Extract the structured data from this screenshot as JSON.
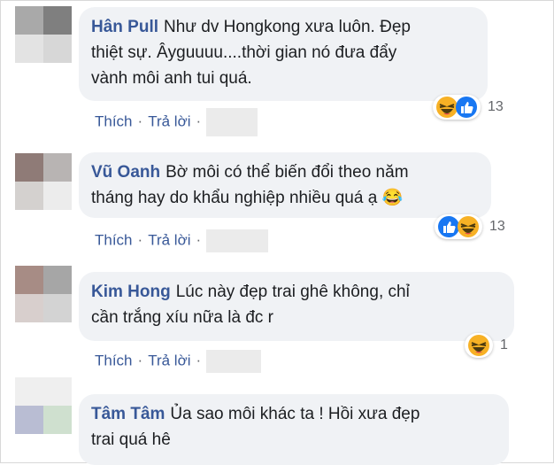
{
  "comments": [
    {
      "author": "Hân Pull",
      "text_lines": [
        "Như dv Hongkong xưa luôn. Đẹp",
        "thiệt sự. Âyguuuu....thời gian nó đưa đẩy",
        "vành môi anh tui quá."
      ],
      "actions": {
        "like": "Thích",
        "reply": "Trả lời"
      },
      "reaction_count": "13",
      "reactions": [
        "haha-icon",
        "like-icon"
      ],
      "avatar_colors": [
        "#a9a9a9",
        "#7f7f7f",
        "#e3e3e3",
        "#d7d7d7"
      ]
    },
    {
      "author": "Vũ Oanh",
      "text_lines": [
        "Bờ môi có thể biến đổi theo năm",
        "tháng hay do khẩu nghiệp nhiều quá ạ 😂"
      ],
      "actions": {
        "like": "Thích",
        "reply": "Trả lời"
      },
      "reaction_count": "13",
      "reactions": [
        "like-icon",
        "haha-icon"
      ],
      "avatar_colors": [
        "#8f7b77",
        "#b8b4b3",
        "#d4d1cf",
        "#ececec"
      ]
    },
    {
      "author": "Kim Hong",
      "text_lines": [
        "Lúc này đẹp trai ghê không, chỉ",
        "cần trắng xíu nữa là đc r"
      ],
      "actions": {
        "like": "Thích",
        "reply": "Trả lời"
      },
      "reaction_count": "1",
      "reactions": [
        "haha-icon"
      ],
      "avatar_colors": [
        "#a78c85",
        "#a6a6a6",
        "#d8cfcd",
        "#d3d3d3"
      ]
    },
    {
      "author": "Tâm Tâm",
      "text_lines": [
        "Ủa sao môi khác ta ! Hồi xưa đẹp",
        "trai quá hê"
      ],
      "avatar_colors": [
        "#efefef",
        "#efefef",
        "#b9bdd3",
        "#cfe0cf"
      ]
    }
  ]
}
